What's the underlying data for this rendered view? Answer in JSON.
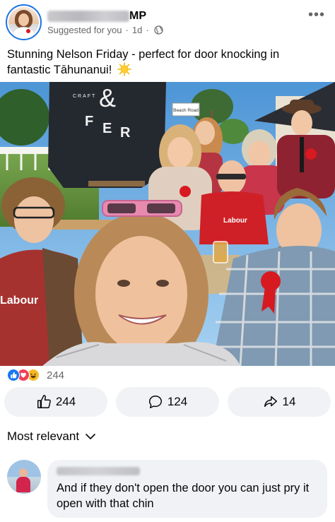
{
  "post": {
    "author_suffix": "MP",
    "suggested_label": "Suggested for you",
    "time": "1d",
    "dot": "·",
    "text": "Stunning Nelson Friday - perfect for door knocking in fantastic Tāhunanui!",
    "emoji": "sun-emoji",
    "photo": {
      "umbrella_text": [
        "CRAFT",
        "&",
        "F",
        "E",
        "R"
      ],
      "sign_text": "Beach Road",
      "shirt_labels": [
        "Labour",
        "Labour",
        "Labour"
      ]
    }
  },
  "reactions": {
    "icons": [
      "like-reaction-icon",
      "love-reaction-icon",
      "haha-reaction-icon"
    ],
    "count": "244"
  },
  "actions": {
    "like": {
      "icon": "thumbs-up-icon",
      "count": "244"
    },
    "comment": {
      "icon": "comment-bubble-icon",
      "count": "124"
    },
    "share": {
      "icon": "share-arrow-icon",
      "count": "14"
    }
  },
  "comments": {
    "sort_label": "Most relevant",
    "sort_icon": "chevron-down-icon",
    "items": [
      {
        "text": "And if they don't open the door you can just pry it open with that chin"
      }
    ]
  },
  "colors": {
    "accent": "#1b74e4",
    "labour_red": "#d71920",
    "secondary_text": "#65676b",
    "button_bg": "#f0f2f5"
  }
}
